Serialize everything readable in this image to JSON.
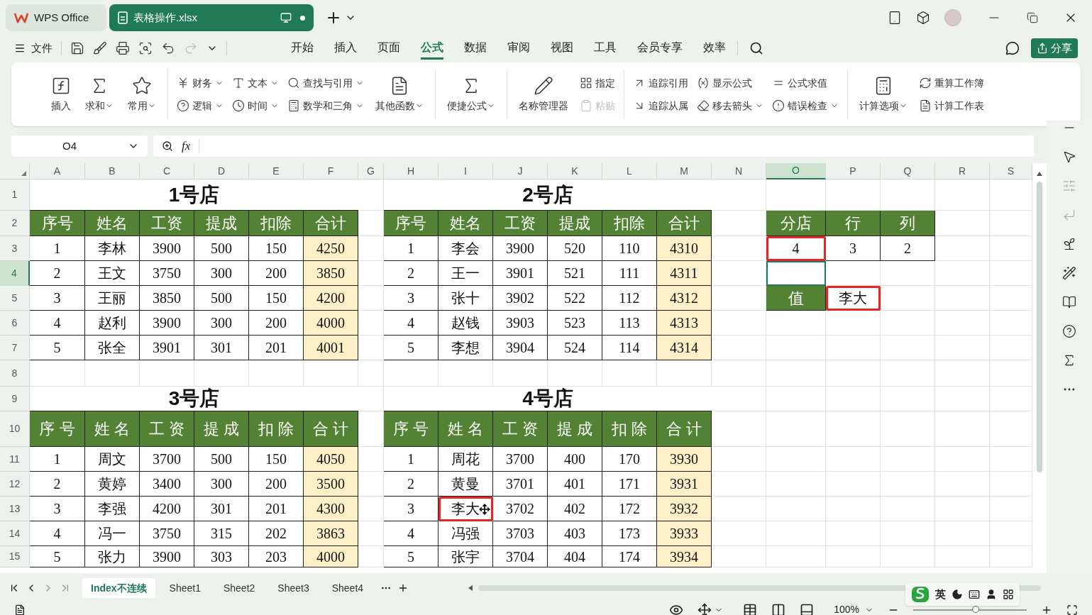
{
  "app_tabs": [
    {
      "label": "WPS Office",
      "selected": false
    },
    {
      "label": "表格操作.xlsx",
      "selected": true
    }
  ],
  "menu": {
    "file_label": "文件",
    "quick_toolbar": [
      {
        "disabled": false
      },
      {
        "disabled": false
      },
      {
        "disabled": false
      },
      {
        "disabled": false
      },
      {
        "disabled": false
      },
      {
        "disabled": true
      }
    ],
    "tabs": [
      {
        "label": "开始",
        "selected": false
      },
      {
        "label": "插入",
        "selected": false
      },
      {
        "label": "页面",
        "selected": false
      },
      {
        "label": "公式",
        "selected": true
      },
      {
        "label": "数据",
        "selected": false
      },
      {
        "label": "审阅",
        "selected": false
      },
      {
        "label": "视图",
        "selected": false
      },
      {
        "label": "工具",
        "selected": false
      },
      {
        "label": "会员专享",
        "selected": false
      },
      {
        "label": "效率",
        "selected": false
      }
    ],
    "share_label": "分享"
  },
  "ribbon": {
    "groups": [
      {
        "items": [
          {
            "kind": "big",
            "label": "插入",
            "dropdown": false,
            "disabled": false
          },
          {
            "kind": "big",
            "label": "求和",
            "dropdown": true,
            "disabled": false
          },
          {
            "kind": "big",
            "label": "常用",
            "dropdown": true,
            "disabled": false
          }
        ]
      },
      {
        "items": [
          {
            "kind": "small",
            "label": "财务",
            "dropdown": true,
            "disabled": false
          },
          {
            "kind": "small",
            "label": "逻辑",
            "dropdown": true,
            "disabled": false
          },
          {
            "kind": "small",
            "label": "文本",
            "dropdown": true,
            "disabled": false
          },
          {
            "kind": "small",
            "label": "时间",
            "dropdown": true,
            "disabled": false
          },
          {
            "kind": "small",
            "label": "查找与引用",
            "dropdown": true,
            "disabled": false
          },
          {
            "kind": "small",
            "label": "数学和三角",
            "dropdown": true,
            "disabled": false
          },
          {
            "kind": "big",
            "label": "其他函数",
            "dropdown": true,
            "disabled": false
          }
        ]
      },
      {
        "items": [
          {
            "kind": "big",
            "label": "便捷公式",
            "dropdown": true,
            "disabled": false
          }
        ]
      },
      {
        "items": [
          {
            "kind": "big",
            "label": "名称管理器",
            "dropdown": false,
            "disabled": false
          },
          {
            "kind": "small",
            "label": "指定",
            "dropdown": false,
            "disabled": false
          },
          {
            "kind": "small",
            "label": "粘贴",
            "dropdown": false,
            "disabled": true
          }
        ]
      },
      {
        "items": [
          {
            "kind": "small",
            "label": "追踪引用",
            "dropdown": false,
            "disabled": false
          },
          {
            "kind": "small",
            "label": "追踪从属",
            "dropdown": false,
            "disabled": false
          },
          {
            "kind": "small",
            "label": "显示公式",
            "dropdown": false,
            "disabled": false
          },
          {
            "kind": "small",
            "label": "移去箭头",
            "dropdown": true,
            "disabled": false
          },
          {
            "kind": "small",
            "label": "公式求值",
            "dropdown": false,
            "disabled": false
          },
          {
            "kind": "small",
            "label": "错误检查",
            "dropdown": true,
            "disabled": false
          }
        ]
      },
      {
        "items": [
          {
            "kind": "big",
            "label": "计算选项",
            "dropdown": true,
            "disabled": false
          },
          {
            "kind": "small",
            "label": "重算工作簿",
            "dropdown": false,
            "disabled": false
          },
          {
            "kind": "small",
            "label": "计算工作表",
            "dropdown": false,
            "disabled": false
          }
        ]
      }
    ]
  },
  "formula_bar": {
    "name_box": "O4",
    "fx_label": "fx"
  },
  "column_headers": [
    {
      "label": "A",
      "selected": false
    },
    {
      "label": "B",
      "selected": false
    },
    {
      "label": "C",
      "selected": false
    },
    {
      "label": "D",
      "selected": false
    },
    {
      "label": "E",
      "selected": false
    },
    {
      "label": "F",
      "selected": false
    },
    {
      "label": "G",
      "selected": false
    },
    {
      "label": "H",
      "selected": false
    },
    {
      "label": "I",
      "selected": false
    },
    {
      "label": "J",
      "selected": false
    },
    {
      "label": "K",
      "selected": false
    },
    {
      "label": "L",
      "selected": false
    },
    {
      "label": "M",
      "selected": false
    },
    {
      "label": "N",
      "selected": false
    },
    {
      "label": "O",
      "selected": true
    },
    {
      "label": "P",
      "selected": false
    },
    {
      "label": "Q",
      "selected": false
    },
    {
      "label": "R",
      "selected": false
    },
    {
      "label": "S",
      "selected": false
    }
  ],
  "row_headers": [
    {
      "label": "1",
      "selected": false
    },
    {
      "label": "2",
      "selected": false
    },
    {
      "label": "3",
      "selected": false
    },
    {
      "label": "4",
      "selected": true
    },
    {
      "label": "5",
      "selected": false
    },
    {
      "label": "6",
      "selected": false
    },
    {
      "label": "7",
      "selected": false
    },
    {
      "label": "8",
      "selected": false
    },
    {
      "label": "9",
      "selected": false
    },
    {
      "label": "10",
      "selected": false
    },
    {
      "label": "11",
      "selected": false
    },
    {
      "label": "12",
      "selected": false
    },
    {
      "label": "13",
      "selected": false
    },
    {
      "label": "14",
      "selected": false
    },
    {
      "label": "15",
      "selected": false
    }
  ],
  "tables": [
    {
      "title": "1号店",
      "headers": [
        "序号",
        "姓名",
        "工资",
        "提成",
        "扣除",
        "合计"
      ],
      "rows": [
        [
          {
            "text": "1",
            "outlined": false
          },
          {
            "text": "李林",
            "outlined": false
          },
          {
            "text": "3900",
            "outlined": false
          },
          {
            "text": "500",
            "outlined": false
          },
          {
            "text": "150",
            "outlined": false
          },
          {
            "text": "4250",
            "outlined": false
          }
        ],
        [
          {
            "text": "2",
            "outlined": false
          },
          {
            "text": "王文",
            "outlined": false
          },
          {
            "text": "3750",
            "outlined": false
          },
          {
            "text": "300",
            "outlined": false
          },
          {
            "text": "200",
            "outlined": false
          },
          {
            "text": "3850",
            "outlined": false
          }
        ],
        [
          {
            "text": "3",
            "outlined": false
          },
          {
            "text": "王丽",
            "outlined": false
          },
          {
            "text": "3850",
            "outlined": false
          },
          {
            "text": "500",
            "outlined": false
          },
          {
            "text": "150",
            "outlined": false
          },
          {
            "text": "4200",
            "outlined": false
          }
        ],
        [
          {
            "text": "4",
            "outlined": false
          },
          {
            "text": "赵利",
            "outlined": false
          },
          {
            "text": "3900",
            "outlined": false
          },
          {
            "text": "300",
            "outlined": false
          },
          {
            "text": "200",
            "outlined": false
          },
          {
            "text": "4000",
            "outlined": false
          }
        ],
        [
          {
            "text": "5",
            "outlined": false
          },
          {
            "text": "张全",
            "outlined": false
          },
          {
            "text": "3901",
            "outlined": false
          },
          {
            "text": "301",
            "outlined": false
          },
          {
            "text": "201",
            "outlined": false
          },
          {
            "text": "4001",
            "outlined": false
          }
        ]
      ]
    },
    {
      "title": "2号店",
      "headers": [
        "序号",
        "姓名",
        "工资",
        "提成",
        "扣除",
        "合计"
      ],
      "rows": [
        [
          {
            "text": "1",
            "outlined": false
          },
          {
            "text": "李会",
            "outlined": false
          },
          {
            "text": "3900",
            "outlined": false
          },
          {
            "text": "520",
            "outlined": false
          },
          {
            "text": "110",
            "outlined": false
          },
          {
            "text": "4310",
            "outlined": false
          }
        ],
        [
          {
            "text": "2",
            "outlined": false
          },
          {
            "text": "王一",
            "outlined": false
          },
          {
            "text": "3901",
            "outlined": false
          },
          {
            "text": "521",
            "outlined": false
          },
          {
            "text": "111",
            "outlined": false
          },
          {
            "text": "4311",
            "outlined": false
          }
        ],
        [
          {
            "text": "3",
            "outlined": false
          },
          {
            "text": "张十",
            "outlined": false
          },
          {
            "text": "3902",
            "outlined": false
          },
          {
            "text": "522",
            "outlined": false
          },
          {
            "text": "112",
            "outlined": false
          },
          {
            "text": "4312",
            "outlined": false
          }
        ],
        [
          {
            "text": "4",
            "outlined": false
          },
          {
            "text": "赵钱",
            "outlined": false
          },
          {
            "text": "3903",
            "outlined": false
          },
          {
            "text": "523",
            "outlined": false
          },
          {
            "text": "113",
            "outlined": false
          },
          {
            "text": "4313",
            "outlined": false
          }
        ],
        [
          {
            "text": "5",
            "outlined": false
          },
          {
            "text": "李想",
            "outlined": false
          },
          {
            "text": "3904",
            "outlined": false
          },
          {
            "text": "524",
            "outlined": false
          },
          {
            "text": "114",
            "outlined": false
          },
          {
            "text": "4314",
            "outlined": false
          }
        ]
      ]
    },
    {
      "title": "3号店",
      "headers": [
        "序 号",
        "姓 名",
        "工 资",
        "提 成",
        "扣 除",
        "合 计"
      ],
      "rows": [
        [
          {
            "text": "1",
            "outlined": false
          },
          {
            "text": "周文",
            "outlined": false
          },
          {
            "text": "3700",
            "outlined": false
          },
          {
            "text": "500",
            "outlined": false
          },
          {
            "text": "150",
            "outlined": false
          },
          {
            "text": "4050",
            "outlined": false
          }
        ],
        [
          {
            "text": "2",
            "outlined": false
          },
          {
            "text": "黄婷",
            "outlined": false
          },
          {
            "text": "3400",
            "outlined": false
          },
          {
            "text": "300",
            "outlined": false
          },
          {
            "text": "200",
            "outlined": false
          },
          {
            "text": "3500",
            "outlined": false
          }
        ],
        [
          {
            "text": "3",
            "outlined": false
          },
          {
            "text": "李强",
            "outlined": false
          },
          {
            "text": "4200",
            "outlined": false
          },
          {
            "text": "301",
            "outlined": false
          },
          {
            "text": "201",
            "outlined": false
          },
          {
            "text": "4300",
            "outlined": false
          }
        ],
        [
          {
            "text": "4",
            "outlined": false
          },
          {
            "text": "冯一",
            "outlined": false
          },
          {
            "text": "3750",
            "outlined": false
          },
          {
            "text": "315",
            "outlined": false
          },
          {
            "text": "202",
            "outlined": false
          },
          {
            "text": "3863",
            "outlined": false
          }
        ],
        [
          {
            "text": "5",
            "outlined": false
          },
          {
            "text": "张力",
            "outlined": false
          },
          {
            "text": "3900",
            "outlined": false
          },
          {
            "text": "303",
            "outlined": false
          },
          {
            "text": "203",
            "outlined": false
          },
          {
            "text": "4000",
            "outlined": false
          }
        ]
      ]
    },
    {
      "title": "4号店",
      "headers": [
        "序 号",
        "姓 名",
        "工 资",
        "提 成",
        "扣 除",
        "合 计"
      ],
      "rows": [
        [
          {
            "text": "1",
            "outlined": false
          },
          {
            "text": "周花",
            "outlined": false
          },
          {
            "text": "3700",
            "outlined": false
          },
          {
            "text": "400",
            "outlined": false
          },
          {
            "text": "170",
            "outlined": false
          },
          {
            "text": "3930",
            "outlined": false
          }
        ],
        [
          {
            "text": "2",
            "outlined": false
          },
          {
            "text": "黄曼",
            "outlined": false
          },
          {
            "text": "3701",
            "outlined": false
          },
          {
            "text": "401",
            "outlined": false
          },
          {
            "text": "171",
            "outlined": false
          },
          {
            "text": "3931",
            "outlined": false
          }
        ],
        [
          {
            "text": "3",
            "outlined": false
          },
          {
            "text": "李大",
            "outlined": true
          },
          {
            "text": "3702",
            "outlined": false
          },
          {
            "text": "402",
            "outlined": false
          },
          {
            "text": "172",
            "outlined": false
          },
          {
            "text": "3932",
            "outlined": false
          }
        ],
        [
          {
            "text": "4",
            "outlined": false
          },
          {
            "text": "冯强",
            "outlined": false
          },
          {
            "text": "3703",
            "outlined": false
          },
          {
            "text": "403",
            "outlined": false
          },
          {
            "text": "173",
            "outlined": false
          },
          {
            "text": "3933",
            "outlined": false
          }
        ],
        [
          {
            "text": "5",
            "outlined": false
          },
          {
            "text": "张宇",
            "outlined": false
          },
          {
            "text": "3704",
            "outlined": false
          },
          {
            "text": "404",
            "outlined": false
          },
          {
            "text": "174",
            "outlined": false
          },
          {
            "text": "3934",
            "outlined": false
          }
        ]
      ]
    }
  ],
  "lookup": {
    "headers": [
      "分店",
      "行",
      "列"
    ],
    "values": [
      {
        "text": "4",
        "outlined": true
      },
      {
        "text": "3",
        "outlined": false
      },
      {
        "text": "2",
        "outlined": false
      }
    ],
    "result_label": "值",
    "result": {
      "text": "李大",
      "outlined": true
    }
  },
  "sheet_tabs": [
    {
      "label": "Index不连续",
      "selected": true
    },
    {
      "label": "Sheet1",
      "selected": false
    },
    {
      "label": "Sheet2",
      "selected": false
    },
    {
      "label": "Sheet3",
      "selected": false
    },
    {
      "label": "Sheet4",
      "selected": false
    }
  ],
  "status_bar": {
    "zoom": "100%",
    "zoom_slider": {
      "level": 0.55
    }
  },
  "ime_bar": {
    "mode_label": "英"
  }
}
